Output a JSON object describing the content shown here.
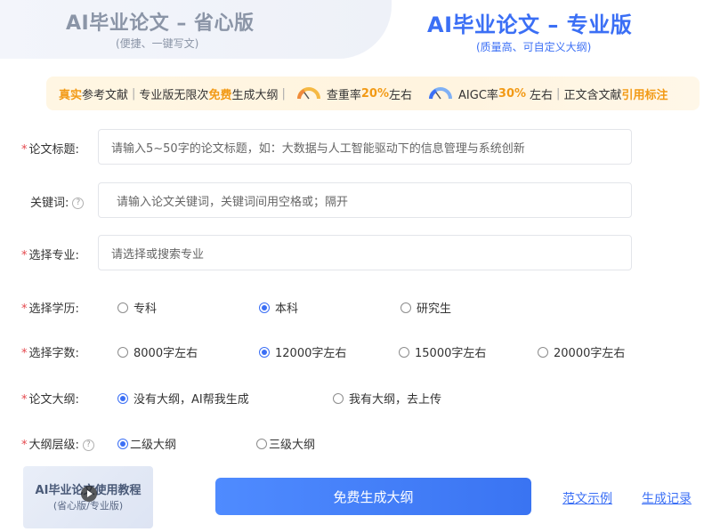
{
  "tabs": {
    "basic": {
      "title": "AI毕业论文 – 省心版",
      "subtitle": "(便捷、一键写文)"
    },
    "pro": {
      "title": "AI毕业论文 – 专业版",
      "subtitle": "(质量高、可自定义大纲)"
    }
  },
  "banner": {
    "p1_highlight": "真实",
    "p1_text": "参考文献",
    "sep": "|",
    "p2_text": "专业版无限次",
    "p2_highlight": "免费",
    "p2_text2": "生成大纲",
    "p3_text": "查重率",
    "p3_value": "20%",
    "p3_suffix": "左右",
    "p4_text": "AIGC率",
    "p4_value": "30%",
    "p4_suffix": "左右",
    "p5_text": "正文含文献",
    "p5_highlight": "引用标注"
  },
  "form": {
    "required_mark": "*",
    "title_label": "论文标题:",
    "title_placeholder": "请输入5~50字的论文标题，如：大数据与人工智能驱动下的信息管理与系统创新",
    "keywords_label": "关键词:",
    "keywords_help": "?",
    "keywords_placeholder": "请输入论文关键词，关键词间用空格或；隔开",
    "major_label": "选择专业:",
    "major_placeholder": "请选择或搜索专业",
    "degree_label": "选择学历:",
    "degree_options": [
      "专科",
      "本科",
      "研究生"
    ],
    "degree_selected": "本科",
    "words_label": "选择字数:",
    "words_options": [
      "8000字左右",
      "12000字左右",
      "15000字左右",
      "20000字左右"
    ],
    "words_selected": "12000字左右",
    "outline_label": "论文大纲:",
    "outline_options": [
      "没有大纲，AI帮我生成",
      "我有大纲，去上传"
    ],
    "outline_selected": "没有大纲，AI帮我生成",
    "level_label": "大纲层级:",
    "level_help": "?",
    "level_options": [
      "二级大纲",
      "三级大纲"
    ],
    "level_selected": "二级大纲"
  },
  "bottom": {
    "tutorial_title": "AI毕业论文使用教程",
    "tutorial_sub": "(省心版/专业版)",
    "generate_button": "免费生成大纲",
    "sample_link": "范文示例",
    "records_link": "生成记录"
  },
  "colors": {
    "accent": "#3b6ff5",
    "required": "#e5484d",
    "highlight_orange": "#f29a16",
    "highlight_red": "#e8604c"
  }
}
